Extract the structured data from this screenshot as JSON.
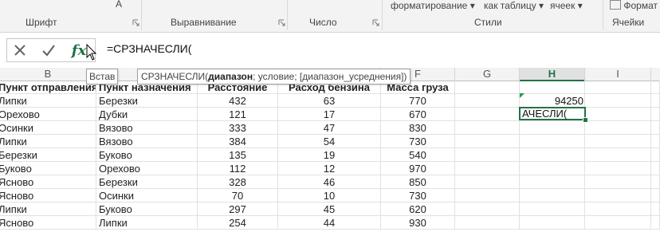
{
  "ribbon": {
    "groups": [
      {
        "label": "Шрифт"
      },
      {
        "label": "Выравнивание"
      },
      {
        "label": "Число"
      },
      {
        "label": "Стили"
      },
      {
        "label": "Ячейки"
      }
    ],
    "styles_top": [
      "форматирование",
      "как таблицу",
      "ячеек"
    ],
    "cells_top": "Формат"
  },
  "formula_bar": {
    "cancel_icon": "close-icon",
    "enter_icon": "check-icon",
    "fx_label": "fx",
    "formula": "=СРЗНАЧЕСЛИ("
  },
  "tooltip": {
    "insert_prefix": "Встав",
    "func": "СРЗНАЧЕСЛИ(",
    "arg_bold": "диапазон",
    "rest": "; условие; [диапазон_усреднения])"
  },
  "columns": [
    "B",
    "C",
    "D",
    "E",
    "F",
    "G",
    "H",
    "I"
  ],
  "selected_column": "H",
  "headers": {
    "b": "Пункт отправления",
    "c": "Пункт назначения",
    "d": "Расстояние",
    "e": "Расход бензина",
    "f": "Масса груза"
  },
  "rows": [
    {
      "b": "Липки",
      "c": "Березки",
      "d": "432",
      "e": "63",
      "f": "770"
    },
    {
      "b": "Орехово",
      "c": "Дубки",
      "d": "121",
      "e": "17",
      "f": "670"
    },
    {
      "b": "Осинки",
      "c": "Вязово",
      "d": "333",
      "e": "47",
      "f": "830"
    },
    {
      "b": "Липки",
      "c": "Вязово",
      "d": "384",
      "e": "54",
      "f": "730"
    },
    {
      "b": "Березки",
      "c": "Буково",
      "d": "135",
      "e": "19",
      "f": "540"
    },
    {
      "b": "Буково",
      "c": "Орехово",
      "d": "112",
      "e": "12",
      "f": "970"
    },
    {
      "b": "Ясново",
      "c": "Березки",
      "d": "328",
      "e": "46",
      "f": "850"
    },
    {
      "b": "Ясново",
      "c": "Осинки",
      "d": "70",
      "e": "10",
      "f": "730"
    },
    {
      "b": "Липки",
      "c": "Буково",
      "d": "297",
      "e": "45",
      "f": "620"
    },
    {
      "b": "Ясново",
      "c": "Липки",
      "d": "254",
      "e": "44",
      "f": "930"
    }
  ],
  "h_values": {
    "row1": "94250",
    "active": "АЧЕСЛИ("
  }
}
